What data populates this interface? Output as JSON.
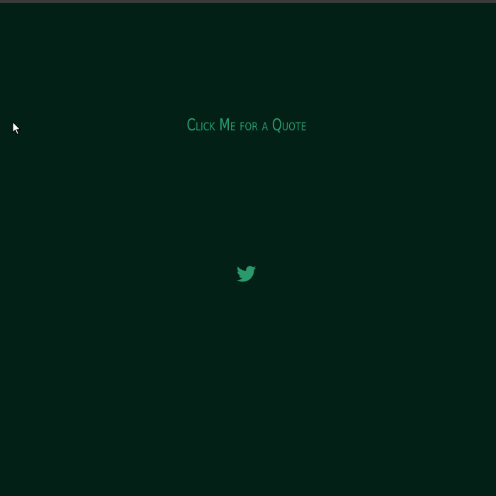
{
  "page": {
    "background": "#032016",
    "accent": "#2a9a6d"
  },
  "quote_button": {
    "label": "Click Me for a Quote"
  },
  "share": {
    "icon": "twitter-icon"
  }
}
